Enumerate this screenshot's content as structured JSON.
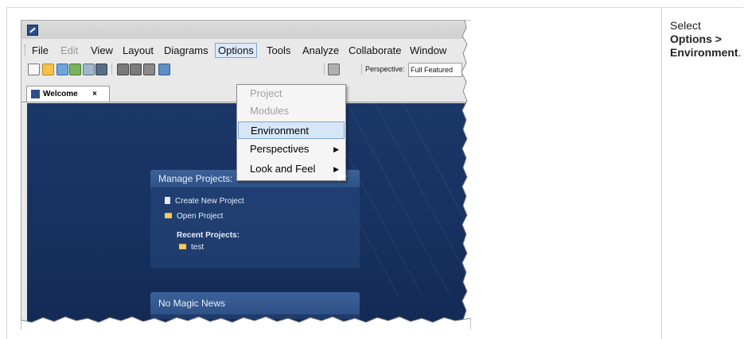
{
  "instruction": {
    "prefix": "Select ",
    "bold": "Options > Environment",
    "suffix": "."
  },
  "window": {
    "menubar": {
      "items": [
        {
          "label": "File",
          "state": "normal"
        },
        {
          "label": "Edit",
          "state": "disabled"
        },
        {
          "label": "View",
          "state": "normal"
        },
        {
          "label": "Layout",
          "state": "normal"
        },
        {
          "label": "Diagrams",
          "state": "normal"
        },
        {
          "label": "Options",
          "state": "active"
        },
        {
          "label": "Tools",
          "state": "normal"
        },
        {
          "label": "Analyze",
          "state": "normal"
        },
        {
          "label": "Collaborate",
          "state": "normal"
        },
        {
          "label": "Window",
          "state": "normal"
        }
      ]
    },
    "toolbar": {
      "perspective_label": "Perspective:",
      "perspective_value": "Full Featured"
    },
    "tab": {
      "label": "Welcome",
      "close": "×"
    },
    "welcome": {
      "manage_header": "Manage Projects:",
      "create_new": "Create New Project",
      "open_project": "Open Project",
      "recent_title": "Recent Projects:",
      "recent_items": [
        "test"
      ],
      "news_header": "No Magic News"
    },
    "options_menu": {
      "items": [
        {
          "label": "Project",
          "state": "disabled",
          "submenu": false
        },
        {
          "label": "Modules",
          "state": "disabled",
          "submenu": false
        },
        {
          "label": "Environment",
          "state": "hover",
          "submenu": false
        },
        {
          "label": "Perspectives",
          "state": "normal",
          "submenu": true
        },
        {
          "label": "Look and Feel",
          "state": "normal",
          "submenu": true
        }
      ],
      "submenu_arrow": "▶"
    }
  },
  "colors": {
    "welcome_bg": "#183262",
    "menu_active_bg": "#dbe9f8",
    "menu_active_border": "#7ea6d3"
  }
}
